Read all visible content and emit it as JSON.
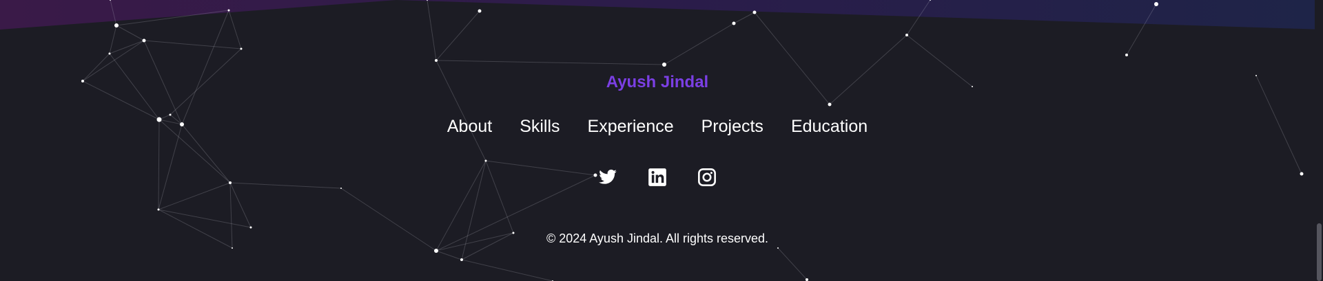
{
  "footer": {
    "brand": "Ayush Jindal",
    "nav": [
      {
        "label": "About"
      },
      {
        "label": "Skills"
      },
      {
        "label": "Experience"
      },
      {
        "label": "Projects"
      },
      {
        "label": "Education"
      }
    ],
    "social": [
      {
        "icon": "twitter-icon"
      },
      {
        "icon": "linkedin-icon"
      },
      {
        "icon": "instagram-icon"
      }
    ],
    "copyright": "© 2024 Ayush Jindal. All rights reserved."
  },
  "colors": {
    "background": "#1c1c24",
    "brand": "#7b3fe4",
    "gradient_start": "#3a1a48",
    "gradient_end": "#1e2448"
  }
}
